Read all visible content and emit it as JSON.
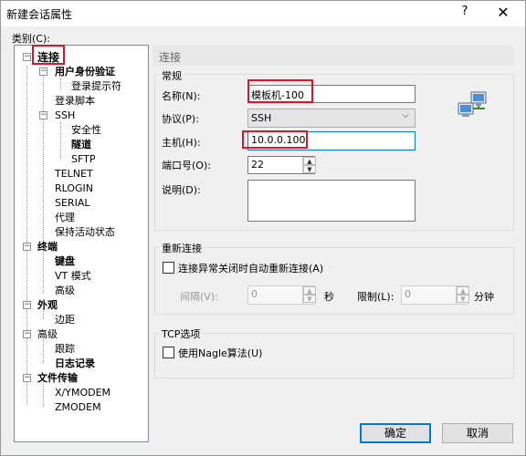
{
  "window": {
    "title": "新建会话属性",
    "help_glyph": "?",
    "close_glyph": "✕"
  },
  "category_label": "类别(C):",
  "tree": {
    "items": [
      {
        "label": "连接",
        "bold": true
      },
      {
        "label": "用户身份验证",
        "bold": true
      },
      {
        "label": "登录提示符",
        "bold": false
      },
      {
        "label": "登录脚本",
        "bold": false
      },
      {
        "label": "SSH",
        "bold": false
      },
      {
        "label": "安全性",
        "bold": false
      },
      {
        "label": "隧道",
        "bold": true
      },
      {
        "label": "SFTP",
        "bold": false
      },
      {
        "label": "TELNET",
        "bold": false
      },
      {
        "label": "RLOGIN",
        "bold": false
      },
      {
        "label": "SERIAL",
        "bold": false
      },
      {
        "label": "代理",
        "bold": false
      },
      {
        "label": "保持活动状态",
        "bold": false
      },
      {
        "label": "终端",
        "bold": true
      },
      {
        "label": "键盘",
        "bold": true
      },
      {
        "label": "VT 模式",
        "bold": false
      },
      {
        "label": "高级",
        "bold": false
      },
      {
        "label": "外观",
        "bold": true
      },
      {
        "label": "边距",
        "bold": false
      },
      {
        "label": "高级",
        "bold": false
      },
      {
        "label": "跟踪",
        "bold": false
      },
      {
        "label": "日志记录",
        "bold": true
      },
      {
        "label": "文件传输",
        "bold": true
      },
      {
        "label": "X/YMODEM",
        "bold": false
      },
      {
        "label": "ZMODEM",
        "bold": false
      }
    ]
  },
  "panel": {
    "header": "连接",
    "general_group": "常规",
    "name_label": "名称(N):",
    "name_value": "模板机-100",
    "protocol_label": "协议(P):",
    "protocol_value": "SSH",
    "host_label": "主机(H):",
    "host_value": "10.0.0.100",
    "port_label": "端口号(O):",
    "port_value": "22",
    "desc_label": "说明(D):",
    "desc_value": "",
    "reconnect_group": "重新连接",
    "reconnect_checkbox": "连接异常关闭时自动重新连接(A)",
    "reconnect_checked": false,
    "interval_label": "间隔(V):",
    "interval_value": "0",
    "interval_unit": "秒",
    "limit_label": "限制(L):",
    "limit_value": "0",
    "limit_unit": "分钟",
    "tcp_group": "TCP选项",
    "nagle_checkbox": "使用Nagle算法(U)",
    "nagle_checked": false
  },
  "buttons": {
    "ok": "确定",
    "cancel": "取消"
  },
  "colors": {
    "highlight_red": "#e81123",
    "focus_blue": "#0078d7"
  }
}
